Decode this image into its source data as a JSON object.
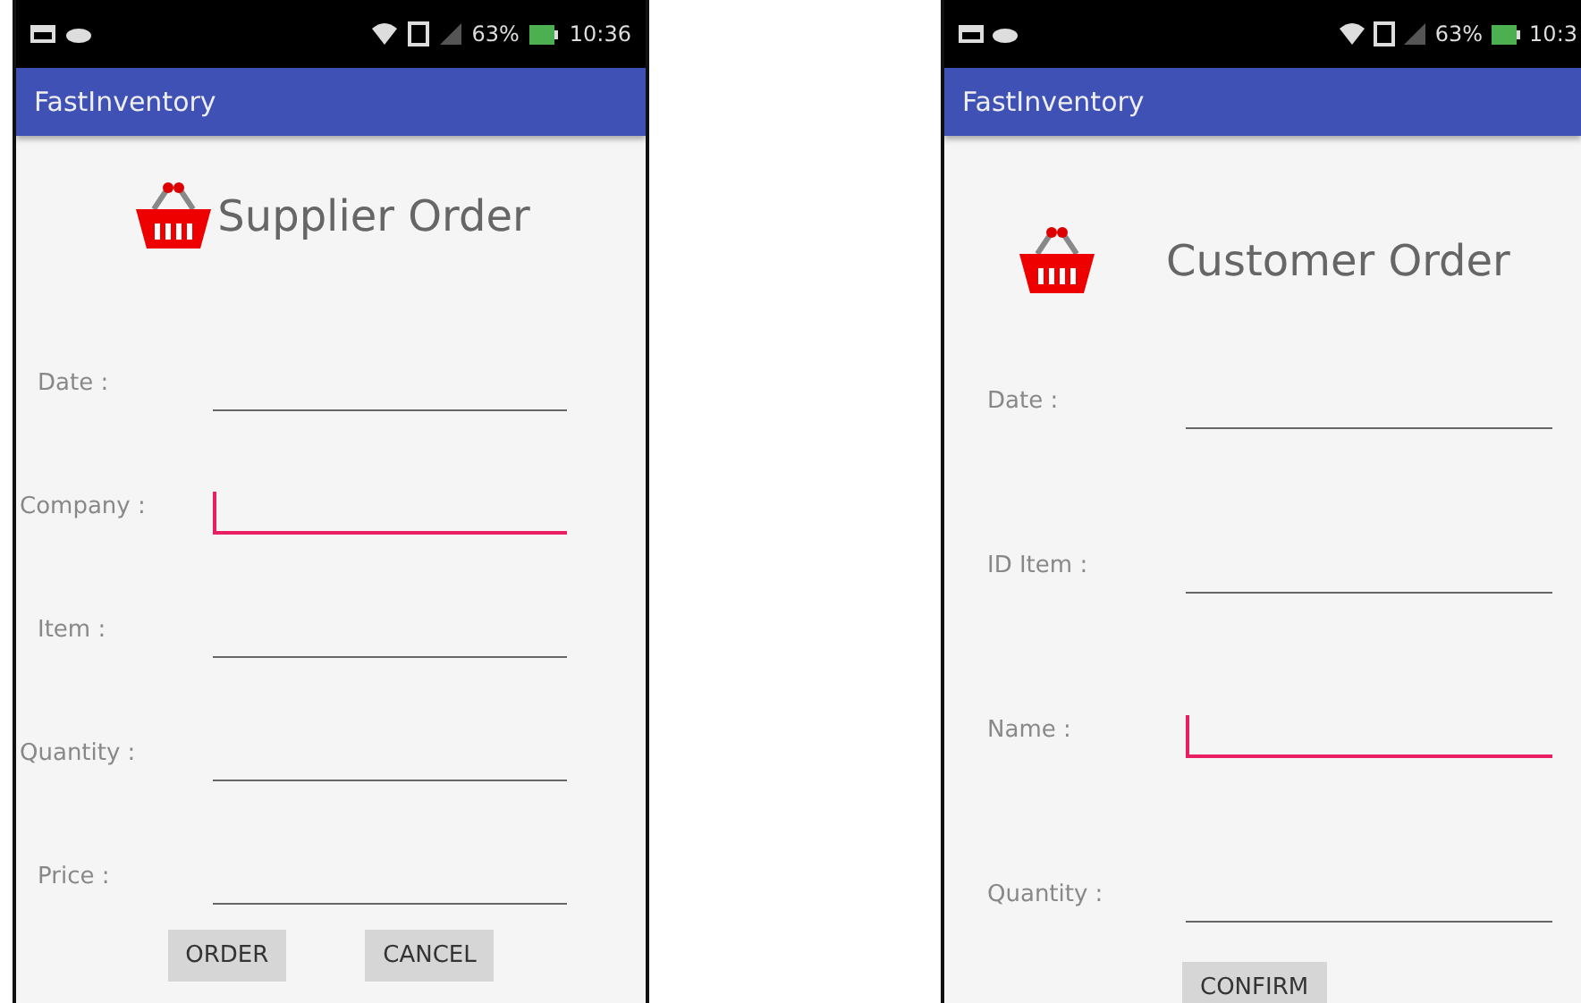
{
  "screens": [
    {
      "status_bar": {
        "battery": "63%",
        "time": "10:36"
      },
      "app_bar": {
        "title": "FastInventory"
      },
      "form_title": "Supplier Order",
      "fields": [
        {
          "label": "Date :",
          "focused": false
        },
        {
          "label": "Company :",
          "focused": true
        },
        {
          "label": "Item :",
          "focused": false
        },
        {
          "label": "Quantity :",
          "focused": false
        },
        {
          "label": "Price :",
          "focused": false
        }
      ],
      "buttons": [
        "ORDER",
        "CANCEL"
      ]
    },
    {
      "status_bar": {
        "battery": "63%",
        "time": "10:3"
      },
      "app_bar": {
        "title": "FastInventory"
      },
      "form_title": "Customer Order",
      "fields": [
        {
          "label": "Date :",
          "focused": false
        },
        {
          "label": "ID Item :",
          "focused": false
        },
        {
          "label": "Name :",
          "focused": true
        },
        {
          "label": "Quantity :",
          "focused": false
        }
      ],
      "buttons": [
        "CONFIRM"
      ]
    }
  ]
}
